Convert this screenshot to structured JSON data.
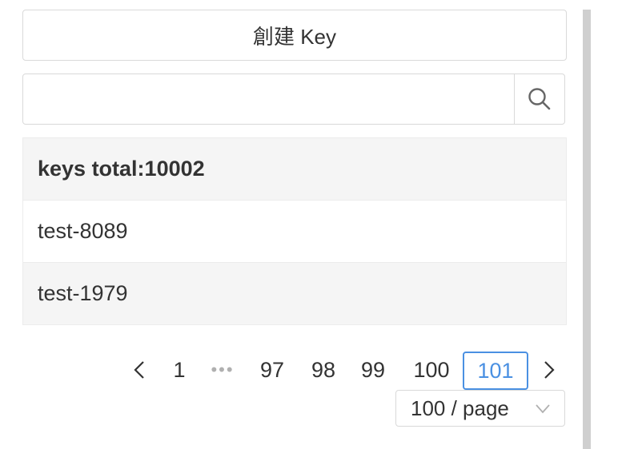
{
  "create_button": {
    "label": "創建 Key"
  },
  "search": {
    "value": "",
    "placeholder": ""
  },
  "key_list": {
    "header": "keys total:10002",
    "items": [
      "test-8089",
      "test-1979"
    ]
  },
  "pagination": {
    "prev_icon": "chevron-left-icon",
    "next_icon": "chevron-right-icon",
    "pages": [
      "1",
      "•••",
      "97",
      "98",
      "99",
      "100",
      "101"
    ],
    "current": "101",
    "prev_label": "<",
    "next_label": ">"
  },
  "page_size": {
    "selected": "100 / page"
  },
  "colors": {
    "accent": "#4a90e2",
    "border": "#d9d9d9",
    "row_alt": "#f5f5f5"
  }
}
